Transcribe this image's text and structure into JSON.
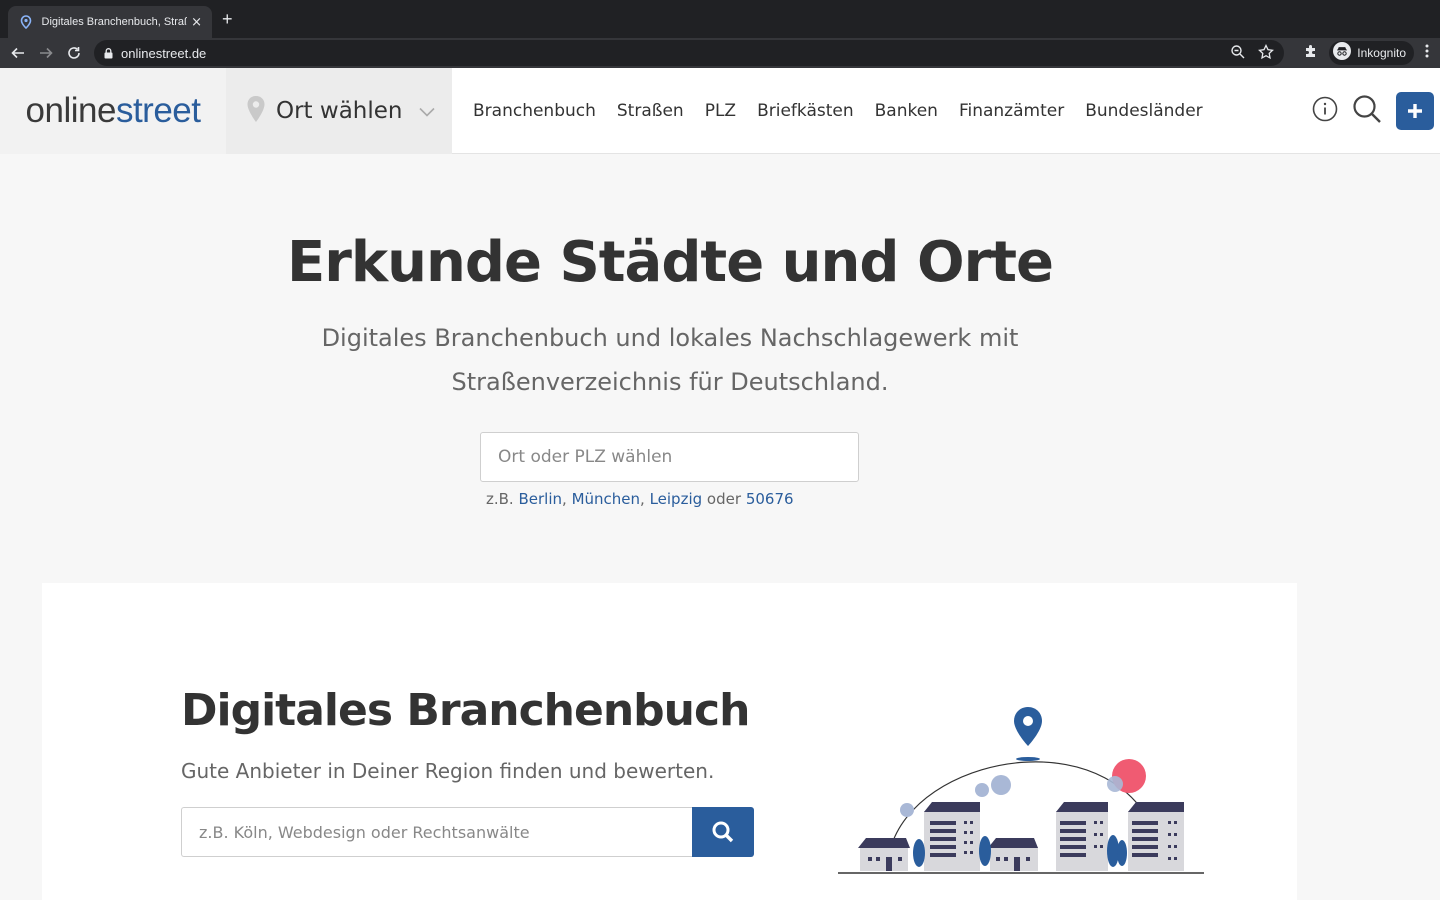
{
  "browser": {
    "tab_title": "Digitales Branchenbuch, Straßenverzeichnis",
    "tab_close": "×",
    "new_tab": "+",
    "url": "onlinestreet.de",
    "profile_label": "Inkognito"
  },
  "header": {
    "logo_part1": "online",
    "logo_part2": "street",
    "city_label": "Ort wählen",
    "nav": [
      "Branchenbuch",
      "Straßen",
      "PLZ",
      "Briefkästen",
      "Banken",
      "Finanzämter",
      "Bundesländer"
    ],
    "accent_color": "#2a5d9c"
  },
  "hero": {
    "title": "Erkunde Städte und Orte",
    "subtitle": "Digitales Branchenbuch und lokales Nachschlagewerk mit Straßenverzeichnis für Deutschland.",
    "input_placeholder": "Ort oder PLZ wählen",
    "examples_prefix": "z.B.",
    "example_1": "Berlin",
    "example_2": "München",
    "example_3": "Leipzig",
    "examples_or": "oder",
    "example_4": "50676"
  },
  "directory": {
    "title": "Digitales Branchenbuch",
    "subtitle": "Gute Anbieter in Deiner Region finden und bewerten.",
    "input_placeholder": "z.B. Köln, Webdesign oder Rechtsanwälte"
  }
}
